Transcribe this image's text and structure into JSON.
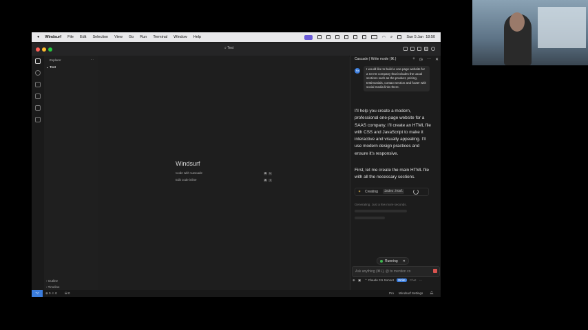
{
  "menubar": {
    "app": "Windsurf",
    "items": [
      "File",
      "Edit",
      "Selection",
      "View",
      "Go",
      "Run",
      "Terminal",
      "Window",
      "Help"
    ],
    "datetime": "Sun 5 Jan  18:50"
  },
  "window": {
    "title": "Test"
  },
  "sidebar": {
    "header": "Explorer",
    "more": "···",
    "folder": "Test",
    "outline": "Outline",
    "timeline": "Timeline"
  },
  "editor": {
    "welcome_title": "Windsurf",
    "actions": [
      {
        "label": "Code with Cascade",
        "keys": [
          "⌘",
          "L"
        ]
      },
      {
        "label": "Edit code inline",
        "keys": [
          "⌘",
          "I"
        ]
      }
    ]
  },
  "cascade": {
    "header": "Cascade | Write mode (⌘.)",
    "user_avatar": "Ra",
    "user_message": "I would like to build a one-page website for a SAAS company that includes the usual sections such as the product, pricing, testimonials, contact section and footer with social media links there.",
    "reply_1": "I'll help you create a modern, professional one-page website for a SAAS company. I'll create an HTML file with CSS and JavaScript to make it interactive and visually appealing. I'll use modern design practices and ensure it's responsive.",
    "reply_2": "First, let me create the main HTML file with all the necessary sections.",
    "creating_label": "Creating",
    "creating_file": "index.html",
    "generating": "Generating. Just a few more seconds.",
    "running": "Running",
    "input_placeholder": "Ask anything (⌘L), @ to mention co",
    "model": "Claude 3.5 Sonnet",
    "mode_write": "Write",
    "mode_chat": "Chat"
  },
  "statusbar": {
    "errors": "0",
    "warnings": "0",
    "ports": "0",
    "plan": "Pro",
    "settings": "Windsurf Settings"
  },
  "colors": {
    "accent": "#3b7ddd",
    "bg": "#1e1e1e",
    "stop": "#d9534f",
    "running_dot": "#3fb950",
    "spark": "#e5b84b"
  }
}
